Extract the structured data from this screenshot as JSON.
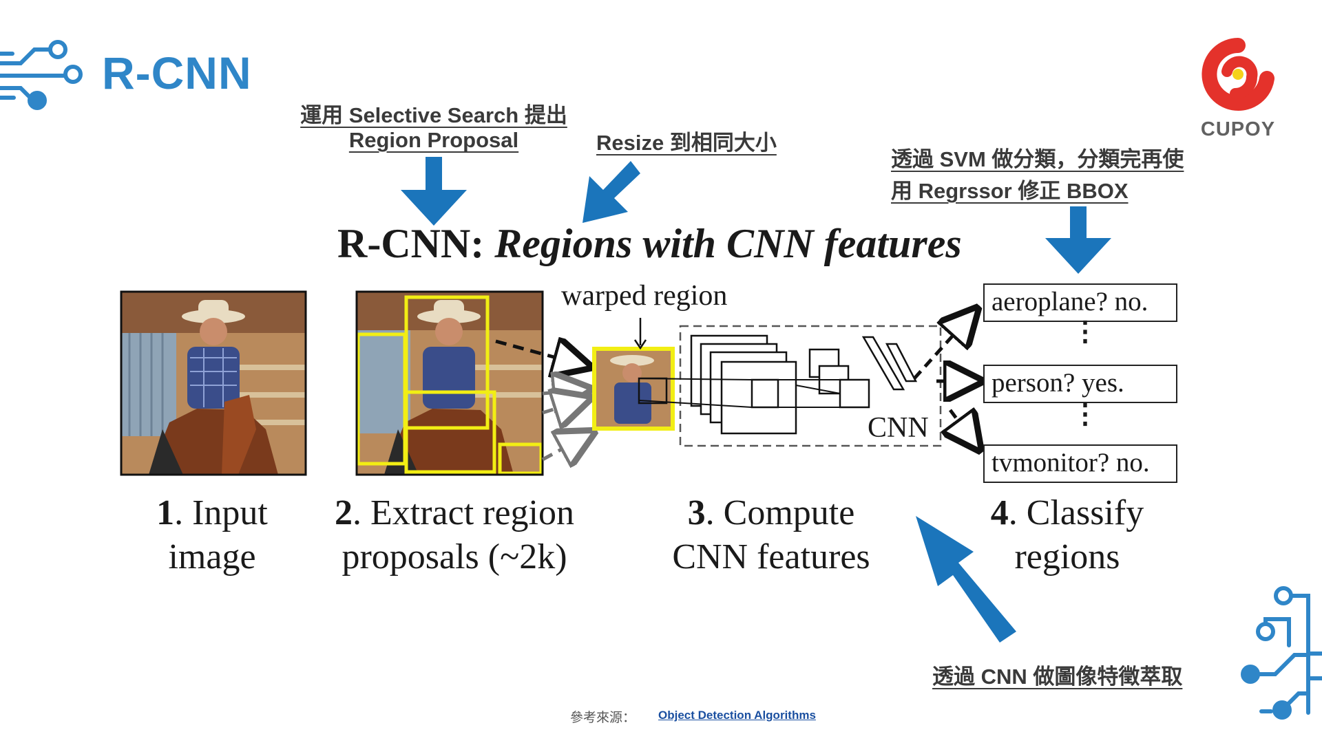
{
  "slide": {
    "title": "R-CNN",
    "brand": "CUPOY"
  },
  "annotations": {
    "selective_search_line1": "運用 Selective Search 提出",
    "selective_search_line2": "Region Proposal",
    "resize": "Resize 到相同大小",
    "svm_line1": "透過 SVM 做分類，分類完再使",
    "svm_line2": "用 Regrssor 修正 BBOX",
    "cnn_extract": "透過 CNN 做圖像特徵萃取"
  },
  "figure": {
    "title_prefix": "R-CNN: ",
    "title_italic": "Regions with CNN features",
    "warped_region": "warped region",
    "cnn_label": "CNN",
    "steps": [
      {
        "num": "1",
        "line1": ". Input",
        "line2": "image"
      },
      {
        "num": "2",
        "line1": ". Extract region",
        "line2": "proposals (~2k)"
      },
      {
        "num": "3",
        "line1": ". Compute",
        "line2": "CNN features"
      },
      {
        "num": "4",
        "line1": ". Classify",
        "line2": "regions"
      }
    ],
    "classifications": [
      "aeroplane? no.",
      "person? yes.",
      "tvmonitor? no."
    ]
  },
  "footer": {
    "source_label": "參考來源：",
    "source_link": "Object Detection Algorithms"
  },
  "colors": {
    "accent_blue": "#1b75bb",
    "title_blue": "#2f86c8",
    "proposal_yellow": "#f2ee14",
    "brand_red": "#e4322b"
  }
}
